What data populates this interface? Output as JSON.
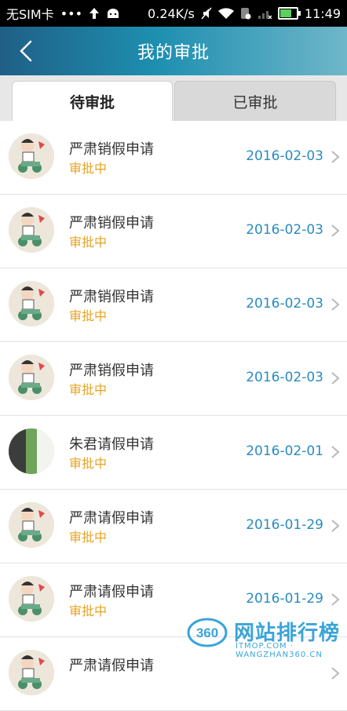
{
  "status_bar": {
    "carrier": "无SIM卡",
    "dots": "•••",
    "speed": "0.24K/s",
    "time": "11:49",
    "battery_level": 0.8
  },
  "header": {
    "title": "我的审批",
    "back_icon": "back-chevron-icon"
  },
  "tabs": [
    {
      "label": "待审批",
      "active": true
    },
    {
      "label": "已审批",
      "active": false
    }
  ],
  "list": [
    {
      "title": "严肃销假申请",
      "status": "审批中",
      "date": "2016-02-03",
      "avatar": "cartoon"
    },
    {
      "title": "严肃销假申请",
      "status": "审批中",
      "date": "2016-02-03",
      "avatar": "cartoon"
    },
    {
      "title": "严肃销假申请",
      "status": "审批中",
      "date": "2016-02-03",
      "avatar": "cartoon"
    },
    {
      "title": "严肃销假申请",
      "status": "审批中",
      "date": "2016-02-03",
      "avatar": "cartoon"
    },
    {
      "title": "朱君请假申请",
      "status": "审批中",
      "date": "2016-02-01",
      "avatar": "photo"
    },
    {
      "title": "严肃请假申请",
      "status": "审批中",
      "date": "2016-01-29",
      "avatar": "cartoon"
    },
    {
      "title": "严肃请假申请",
      "status": "审批中",
      "date": "2016-01-29",
      "avatar": "cartoon"
    },
    {
      "title": "严肃请假申请",
      "status": "",
      "date": "",
      "avatar": "cartoon"
    }
  ],
  "watermark": {
    "logo_text": "360",
    "text": "网站排行榜",
    "sub": "ITMOP.COM",
    "url": "WANGZHAN360.CN"
  },
  "colors": {
    "status": "#e7a322",
    "date": "#2a8bc1",
    "header_start": "#1f5f86",
    "header_end": "#6fb6c9"
  }
}
